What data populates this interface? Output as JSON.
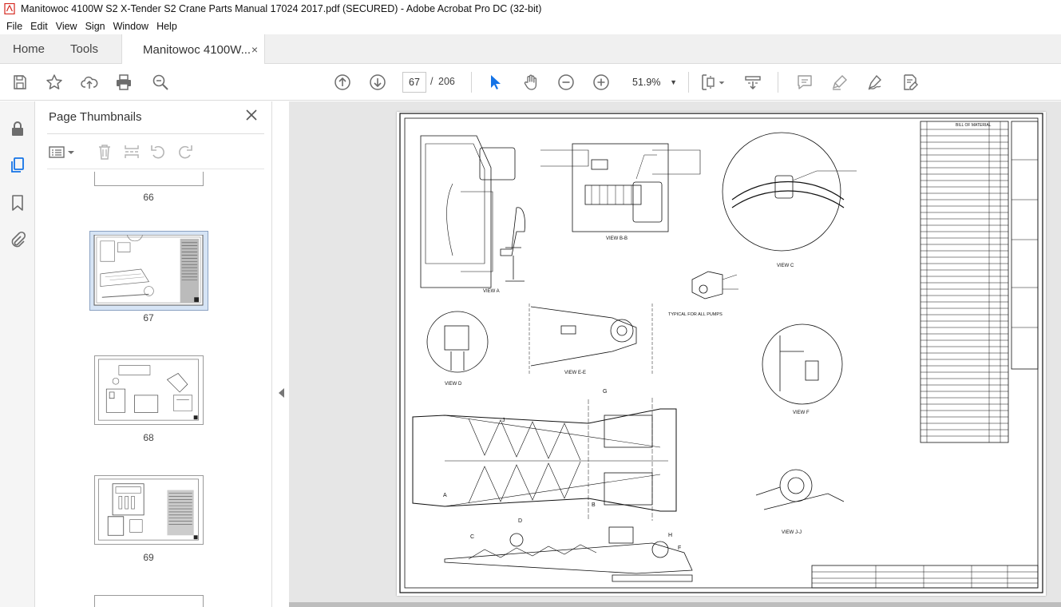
{
  "window": {
    "title": "Manitowoc 4100W S2 X-Tender S2 Crane Parts Manual 17024 2017.pdf (SECURED) - Adobe Acrobat Pro DC (32-bit)"
  },
  "menu": [
    "File",
    "Edit",
    "View",
    "Sign",
    "Window",
    "Help"
  ],
  "tabs": {
    "home": "Home",
    "tools": "Tools",
    "document": "Manitowoc 4100W...",
    "close": "×"
  },
  "toolbar": {
    "current_page": "67",
    "page_separator": "/",
    "total_pages": "206",
    "zoom": "51.9%",
    "zoom_caret": "▼"
  },
  "thumbnails": {
    "title": "Page Thumbnails",
    "pages": [
      "66",
      "67",
      "68",
      "69"
    ],
    "selected_page": "67"
  },
  "drawing": {
    "views": [
      "VIEW A",
      "VIEW B-B",
      "VIEW C",
      "VIEW D",
      "VIEW E-E",
      "VIEW F",
      "VIEW J-J"
    ],
    "note_pumps": "TYPICAL FOR ALL PUMPS",
    "bom_title": "BILL OF MATERIAL",
    "section_letters": [
      "A",
      "B",
      "C",
      "D",
      "F",
      "G",
      "H",
      "J"
    ]
  },
  "colors": {
    "accent_blue": "#1473e6",
    "icon_gray": "#6d6d6d",
    "app_red": "#d4261d"
  }
}
